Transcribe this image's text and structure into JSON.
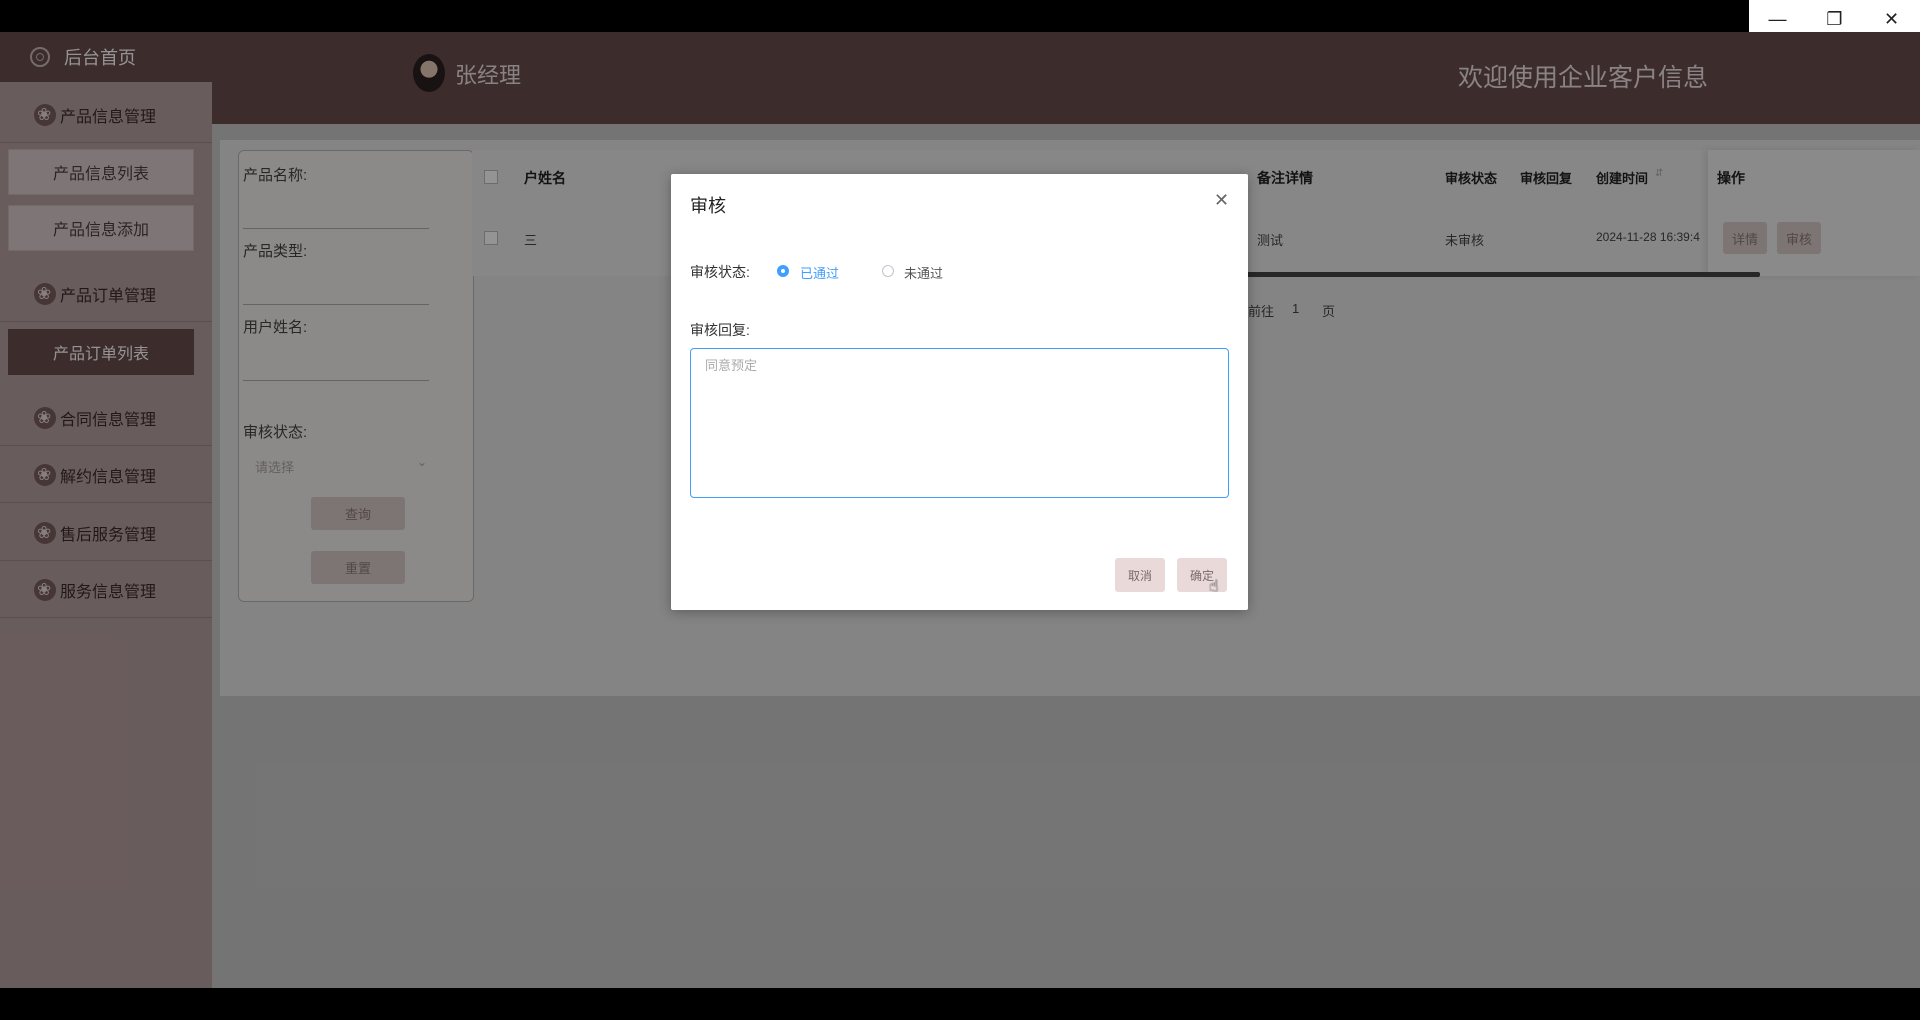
{
  "window": {
    "minimize_icon": "minimize-icon",
    "maximize_icon": "restore-icon",
    "close_icon": "close-icon"
  },
  "sidebar": {
    "home_label": "后台首页",
    "groups": [
      {
        "label": "产品信息管理",
        "items": [
          "产品信息列表",
          "产品信息添加"
        ]
      },
      {
        "label": "产品订单管理",
        "items": [
          "产品订单列表"
        ]
      },
      {
        "label": "合同信息管理",
        "items": []
      },
      {
        "label": "解约信息管理",
        "items": []
      },
      {
        "label": "售后服务管理",
        "items": []
      },
      {
        "label": "服务信息管理",
        "items": []
      }
    ],
    "active_item": "产品订单列表"
  },
  "header": {
    "username": "张经理",
    "welcome": "欢迎使用企业客户信息"
  },
  "search": {
    "product_name_label": "产品名称:",
    "product_type_label": "产品类型:",
    "user_name_label": "用户姓名:",
    "status_label": "审核状态:",
    "status_placeholder": "请选择",
    "query_button": "查询",
    "reset_button": "重置"
  },
  "table": {
    "headers": {
      "user_name": "户姓名",
      "remark": "备注详情",
      "status": "审核状态",
      "reply": "审核回复",
      "created": "创建时间",
      "ops": "操作"
    },
    "rows": [
      {
        "user_name": "三",
        "remark": "测试",
        "status": "未审核",
        "reply": "",
        "created": "2024-11-28 16:39:4",
        "btn_detail": "详情",
        "btn_audit": "审核"
      }
    ]
  },
  "pagination": {
    "prefix": "前往",
    "page": "1",
    "suffix": "页"
  },
  "dialog": {
    "title": "审核",
    "status_label": "审核状态:",
    "option_pass": "已通过",
    "option_fail": "未通过",
    "selected": "已通过",
    "reply_label": "审核回复:",
    "reply_placeholder": "同意预定",
    "cancel_button": "取消",
    "confirm_button": "确定"
  },
  "colors": {
    "primary_dark": "#6a4c4c",
    "sidebar": "#b69f9f",
    "accent_blue": "#409eff",
    "button_pink": "#ead9d9"
  }
}
